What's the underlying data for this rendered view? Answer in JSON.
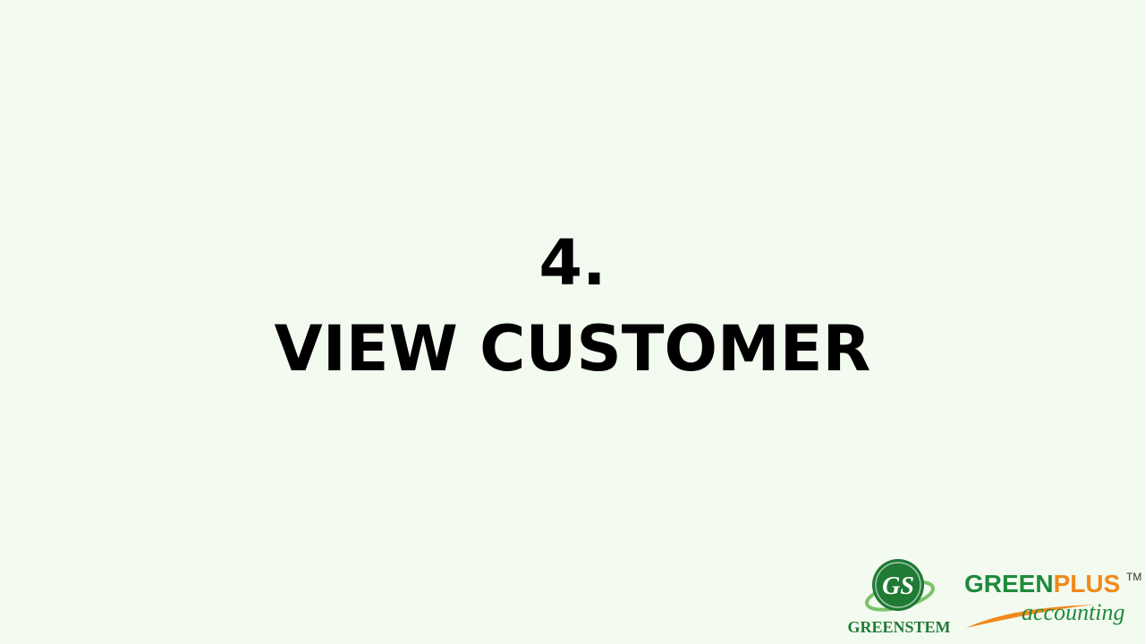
{
  "slide": {
    "number_line": "4.",
    "title_line": "VIEW CUSTOMER"
  },
  "logos": {
    "greenstem": {
      "mark_text": "GS",
      "wordmark": "GREENSTEM",
      "icon": "greenstem-logo-icon"
    },
    "greenplus": {
      "word_green": "GREEN",
      "word_orange": "PLUS",
      "trademark": "TM",
      "subtitle": "accounting",
      "icon": "greenplus-swoosh-icon"
    }
  },
  "colors": {
    "background": "#f3faf0",
    "text": "#000000",
    "brand_green": "#1f8a3a",
    "brand_orange": "#f08a1c"
  }
}
